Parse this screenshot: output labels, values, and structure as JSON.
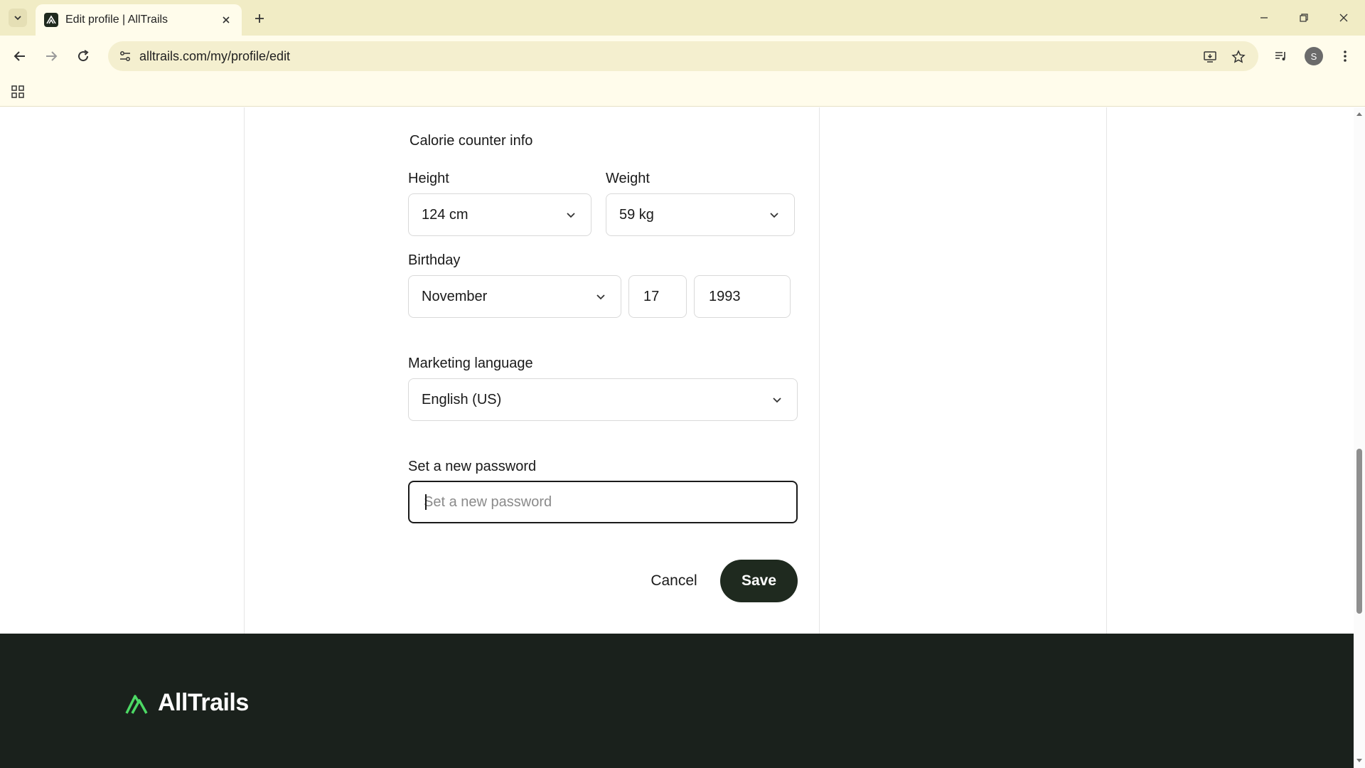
{
  "browser": {
    "tab_title": "Edit profile | AllTrails",
    "url": "alltrails.com/my/profile/edit",
    "profile_initial": "S"
  },
  "form": {
    "section_title": "Calorie counter info",
    "height": {
      "label": "Height",
      "value": "124 cm"
    },
    "weight": {
      "label": "Weight",
      "value": "59 kg"
    },
    "birthday": {
      "label": "Birthday",
      "month": "November",
      "day": "17",
      "year": "1993"
    },
    "marketing_language": {
      "label": "Marketing language",
      "value": "English (US)"
    },
    "password": {
      "label": "Set a new password",
      "placeholder": "Set a new password",
      "value": ""
    },
    "cancel_label": "Cancel",
    "save_label": "Save"
  },
  "footer": {
    "brand": "AllTrails"
  },
  "colors": {
    "tabbar_bg": "#f1ecc5",
    "toolbar_bg": "#fffceb",
    "save_button_bg": "#1f2a1f",
    "footer_bg": "#1a211c",
    "brand_accent": "#4cd964"
  }
}
